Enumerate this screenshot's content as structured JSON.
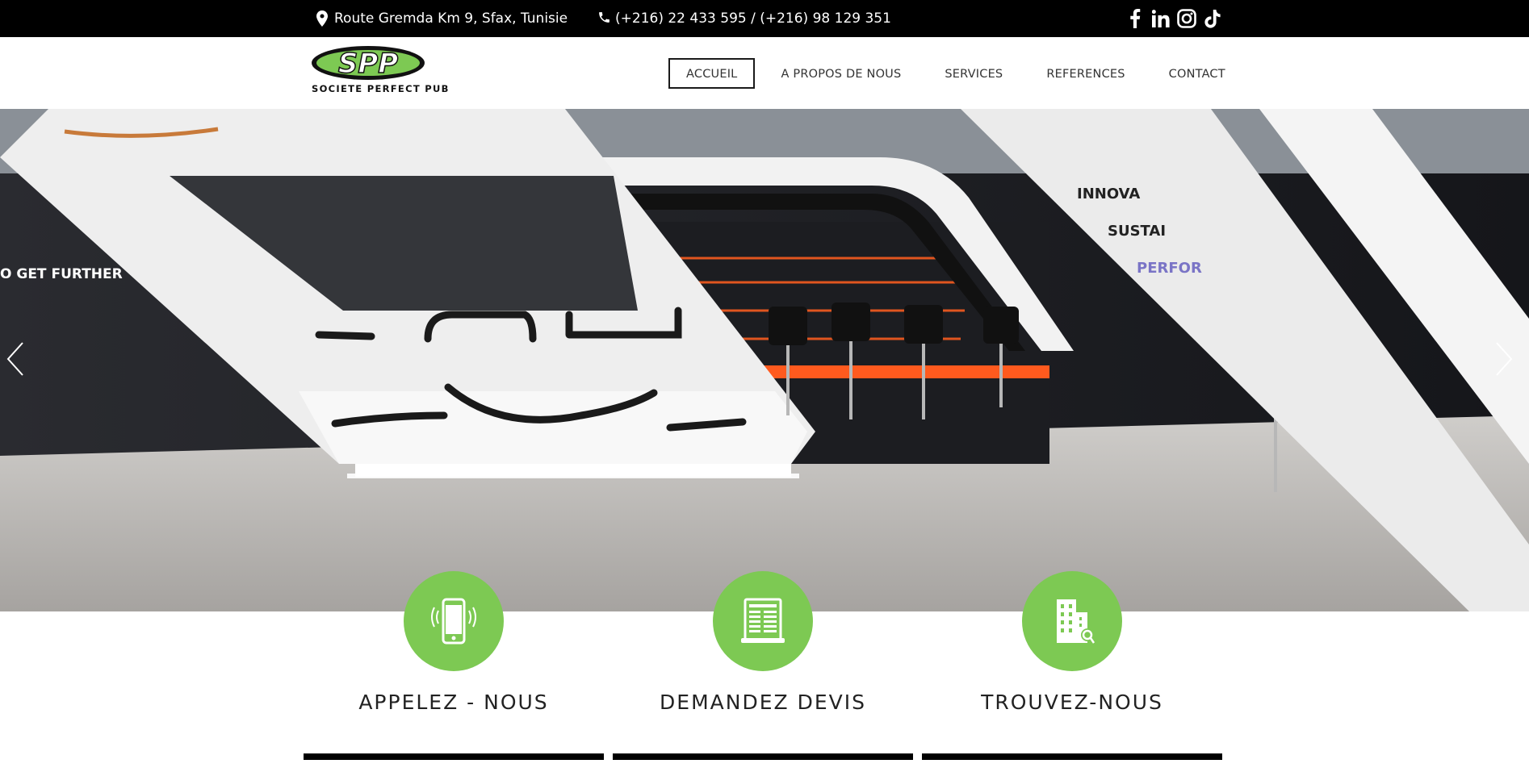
{
  "topbar": {
    "address": "Route Gremda Km 9, Sfax, Tunisie",
    "phone": "(+216) 22 433 595 / (+216) 98 129 351",
    "socials": [
      "facebook-icon",
      "linkedin-icon",
      "instagram-icon",
      "tiktok-icon"
    ]
  },
  "header": {
    "logo_text": "SPP",
    "brand_name": "SOCIETE PERFECT PUB",
    "nav": [
      {
        "label": "ACCUEIL",
        "active": true
      },
      {
        "label": "A PROPOS DE NOUS",
        "active": false
      },
      {
        "label": "SERVICES",
        "active": false
      },
      {
        "label": "REFERENCES",
        "active": false
      },
      {
        "label": "CONTACT",
        "active": false
      }
    ]
  },
  "hero": {
    "slide_texts": [
      "O GET FURTHER",
      "INNOVA",
      "SUSTAI",
      "PERFOR"
    ]
  },
  "features": [
    {
      "label": "APPELEZ - NOUS",
      "icon": "smartphone-icon"
    },
    {
      "label": "DEMANDEZ DEVIS",
      "icon": "quote-document-icon"
    },
    {
      "label": "TROUVEZ-NOUS",
      "icon": "building-location-icon"
    }
  ],
  "colors": {
    "accent_green": "#7dc953",
    "topbar_bg": "#000000",
    "text_dark": "#222222"
  }
}
